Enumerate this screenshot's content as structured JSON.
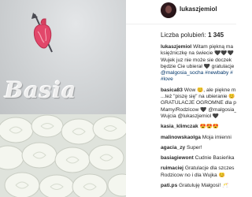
{
  "post": {
    "username": "lukaszjemiol",
    "likes_label": "Liczba polubień:",
    "likes_count": "1 345",
    "photo_text": "Basia"
  },
  "caption": {
    "user": "lukaszjemiol",
    "lines": [
      "Witam piękną ma",
      "księżniczkę na świecie 🖤🖤🖤",
      "Wujek juz nie może sie doczek",
      "będzie Cie ubierał 🖤 gratulacje",
      "@malgosia_socha #newbaby #",
      "#love"
    ]
  },
  "comments": [
    {
      "user": "basica83",
      "lines": [
        "Wow 😊, ale piękne m",
        "...też \"piszę się\" na ubieranie 😊",
        "GRATULACJE OGROMNE dla p",
        "Mamy/Rodzicow 🖤 @malgosia_so",
        "Wujcia @lukaszjemiol 🖤"
      ]
    },
    {
      "user": "kasia_klimczak",
      "lines": [
        "😍😍😍"
      ]
    },
    {
      "user": "malinowskaolga",
      "lines": [
        "Moja imienni"
      ]
    },
    {
      "user": "agacia_zy",
      "lines": [
        "Super!"
      ]
    },
    {
      "user": "basiagiewont",
      "lines": [
        "Cudnie Basieńka"
      ]
    },
    {
      "user": "ruimaciej",
      "lines": [
        "Gratulacje dla szczes",
        "Rodzicow no i dla Wujka 😊"
      ]
    },
    {
      "user": "pati.ps",
      "lines": [
        "Gratuluję Małgosi! 🥂"
      ]
    }
  ],
  "icons": {
    "avatar": "profile-photo",
    "heart_patch": "anatomical-heart-icon"
  },
  "colors": {
    "username": "#262626",
    "mention": "#003569",
    "separator": "#efefef"
  }
}
